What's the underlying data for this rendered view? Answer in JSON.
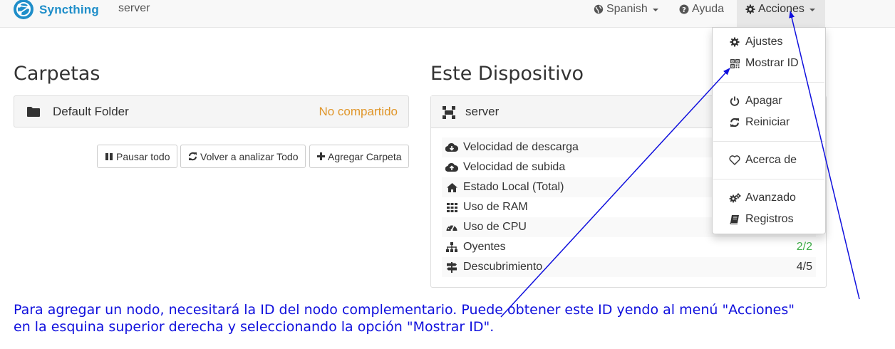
{
  "navbar": {
    "brand": "Syncthing",
    "host": "server",
    "language_label": "Spanish",
    "help_label": "Ayuda",
    "actions_label": "Acciones"
  },
  "folders": {
    "heading": "Carpetas",
    "items": [
      {
        "name": "Default Folder",
        "status": "No compartido"
      }
    ],
    "buttons": {
      "pause_all": "Pausar todo",
      "rescan_all": "Volver a analizar Todo",
      "add_folder": "Agregar Carpeta"
    }
  },
  "device": {
    "heading": "Este Dispositivo",
    "name": "server",
    "stats": [
      {
        "icon": "cloud-download-icon",
        "label": "Velocidad de descarga",
        "value": ""
      },
      {
        "icon": "cloud-upload-icon",
        "label": "Velocidad de subida",
        "value": ""
      },
      {
        "icon": "home-icon",
        "label": "Estado Local (Total)",
        "value": ""
      },
      {
        "icon": "grid-icon",
        "label": "Uso de RAM",
        "value": ""
      },
      {
        "icon": "dashboard-icon",
        "label": "Uso de CPU",
        "value": ""
      },
      {
        "icon": "sitemap-icon",
        "label": "Oyentes",
        "value": "2/2"
      },
      {
        "icon": "signpost-icon",
        "label": "Descubrimiento",
        "value": "4/5"
      }
    ]
  },
  "actions_menu": {
    "settings": "Ajustes",
    "show_id": "Mostrar ID",
    "shutdown": "Apagar",
    "restart": "Reiniciar",
    "about": "Acerca de",
    "advanced": "Avanzado",
    "logs": "Registros"
  },
  "annotation": {
    "line1": "Para agregar un nodo, necesitará la ID del nodo complementario. Puede obtener este ID yendo al menú \"Acciones\"",
    "line2": "en la esquina superior derecha y seleccionando la opción \"Mostrar ID\"."
  },
  "colors": {
    "brand": "#1f8ec9",
    "folder_status": "#e0962a",
    "ok_green": "#3fae48",
    "annotation_blue": "#1010dd"
  }
}
